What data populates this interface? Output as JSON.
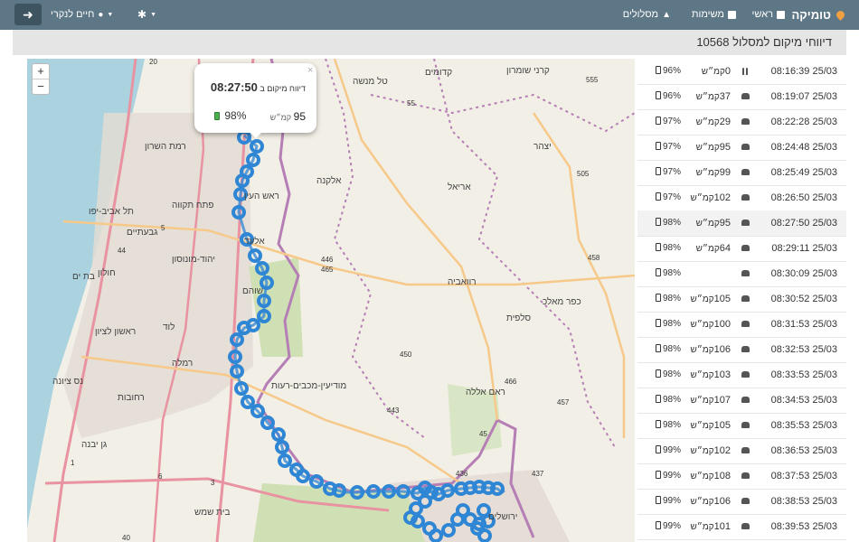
{
  "nav": {
    "brand": "טומיקה",
    "main": "ראשי",
    "lists": "משימות",
    "routes": "מסלולים",
    "user": "חיים לנקרי",
    "logout": "➜"
  },
  "title": "דיווחי מיקום למסלול 10568",
  "map": {
    "zoom_in": "+",
    "zoom_out": "−",
    "labels": [
      "תל אביב-יפו",
      "חולון",
      "בת ים",
      "ראשון לציון",
      "פתח תקווה",
      "רמת השרון",
      "גבעתיים",
      "יהוד-מונוסון",
      "אלעד",
      "ראש העין",
      "שוהם",
      "מודיעין-מכבים-רעות",
      "רחובות",
      "נס ציונה",
      "רמלה",
      "לוד",
      "גן יבנה",
      "ירושלים",
      "אריאל",
      "רוואביה",
      "ראם אללה",
      "כפר מאלכ",
      "סלפית",
      "בית שמש",
      "קדומים",
      "קרני שומרון",
      "טל מנשה",
      "יצהר",
      "אלקנה"
    ],
    "road_numbers": [
      "55",
      "555",
      "505",
      "5",
      "446",
      "465",
      "458",
      "450",
      "466",
      "457",
      "443",
      "45",
      "436",
      "437",
      "1",
      "3",
      "6",
      "40",
      "44",
      "20"
    ]
  },
  "popup": {
    "close": "×",
    "label": "דיווח מיקום ב",
    "time": "08:27:50",
    "speed": "95",
    "speed_unit": "קמ״ש",
    "battery": "98%"
  },
  "reports": [
    {
      "time": "08:16:39 25/03",
      "status": "pause",
      "speed": "0",
      "unit": "קמ״ש",
      "battery": "96%"
    },
    {
      "time": "08:19:07 25/03",
      "status": "car",
      "speed": "37",
      "unit": "קמ״ש",
      "battery": "96%"
    },
    {
      "time": "08:22:28 25/03",
      "status": "car",
      "speed": "29",
      "unit": "קמ״ש",
      "battery": "97%"
    },
    {
      "time": "08:24:48 25/03",
      "status": "car",
      "speed": "95",
      "unit": "קמ״ש",
      "battery": "97%"
    },
    {
      "time": "08:25:49 25/03",
      "status": "car",
      "speed": "99",
      "unit": "קמ״ש",
      "battery": "97%"
    },
    {
      "time": "08:26:50 25/03",
      "status": "car",
      "speed": "102",
      "unit": "קמ״ש",
      "battery": "97%"
    },
    {
      "time": "08:27:50 25/03",
      "status": "car",
      "speed": "95",
      "unit": "קמ״ש",
      "battery": "98%"
    },
    {
      "time": "08:29:11 25/03",
      "status": "car",
      "speed": "64",
      "unit": "קמ״ש",
      "battery": "98%"
    },
    {
      "time": "08:30:09 25/03",
      "status": "car",
      "speed": "",
      "unit": "",
      "battery": "98%"
    },
    {
      "time": "08:30:52 25/03",
      "status": "car",
      "speed": "105",
      "unit": "קמ״ש",
      "battery": "98%"
    },
    {
      "time": "08:31:53 25/03",
      "status": "car",
      "speed": "100",
      "unit": "קמ״ש",
      "battery": "98%"
    },
    {
      "time": "08:32:53 25/03",
      "status": "car",
      "speed": "106",
      "unit": "קמ״ש",
      "battery": "98%"
    },
    {
      "time": "08:33:53 25/03",
      "status": "car",
      "speed": "103",
      "unit": "קמ״ש",
      "battery": "98%"
    },
    {
      "time": "08:34:53 25/03",
      "status": "car",
      "speed": "107",
      "unit": "קמ״ש",
      "battery": "98%"
    },
    {
      "time": "08:35:53 25/03",
      "status": "car",
      "speed": "105",
      "unit": "קמ״ש",
      "battery": "98%"
    },
    {
      "time": "08:36:53 25/03",
      "status": "car",
      "speed": "102",
      "unit": "קמ״ש",
      "battery": "99%"
    },
    {
      "time": "08:37:53 25/03",
      "status": "car",
      "speed": "108",
      "unit": "קמ״ש",
      "battery": "99%"
    },
    {
      "time": "08:38:53 25/03",
      "status": "car",
      "speed": "106",
      "unit": "קמ״ש",
      "battery": "99%"
    },
    {
      "time": "08:39:53 25/03",
      "status": "car",
      "speed": "101",
      "unit": "קמ״ש",
      "battery": "99%"
    }
  ]
}
